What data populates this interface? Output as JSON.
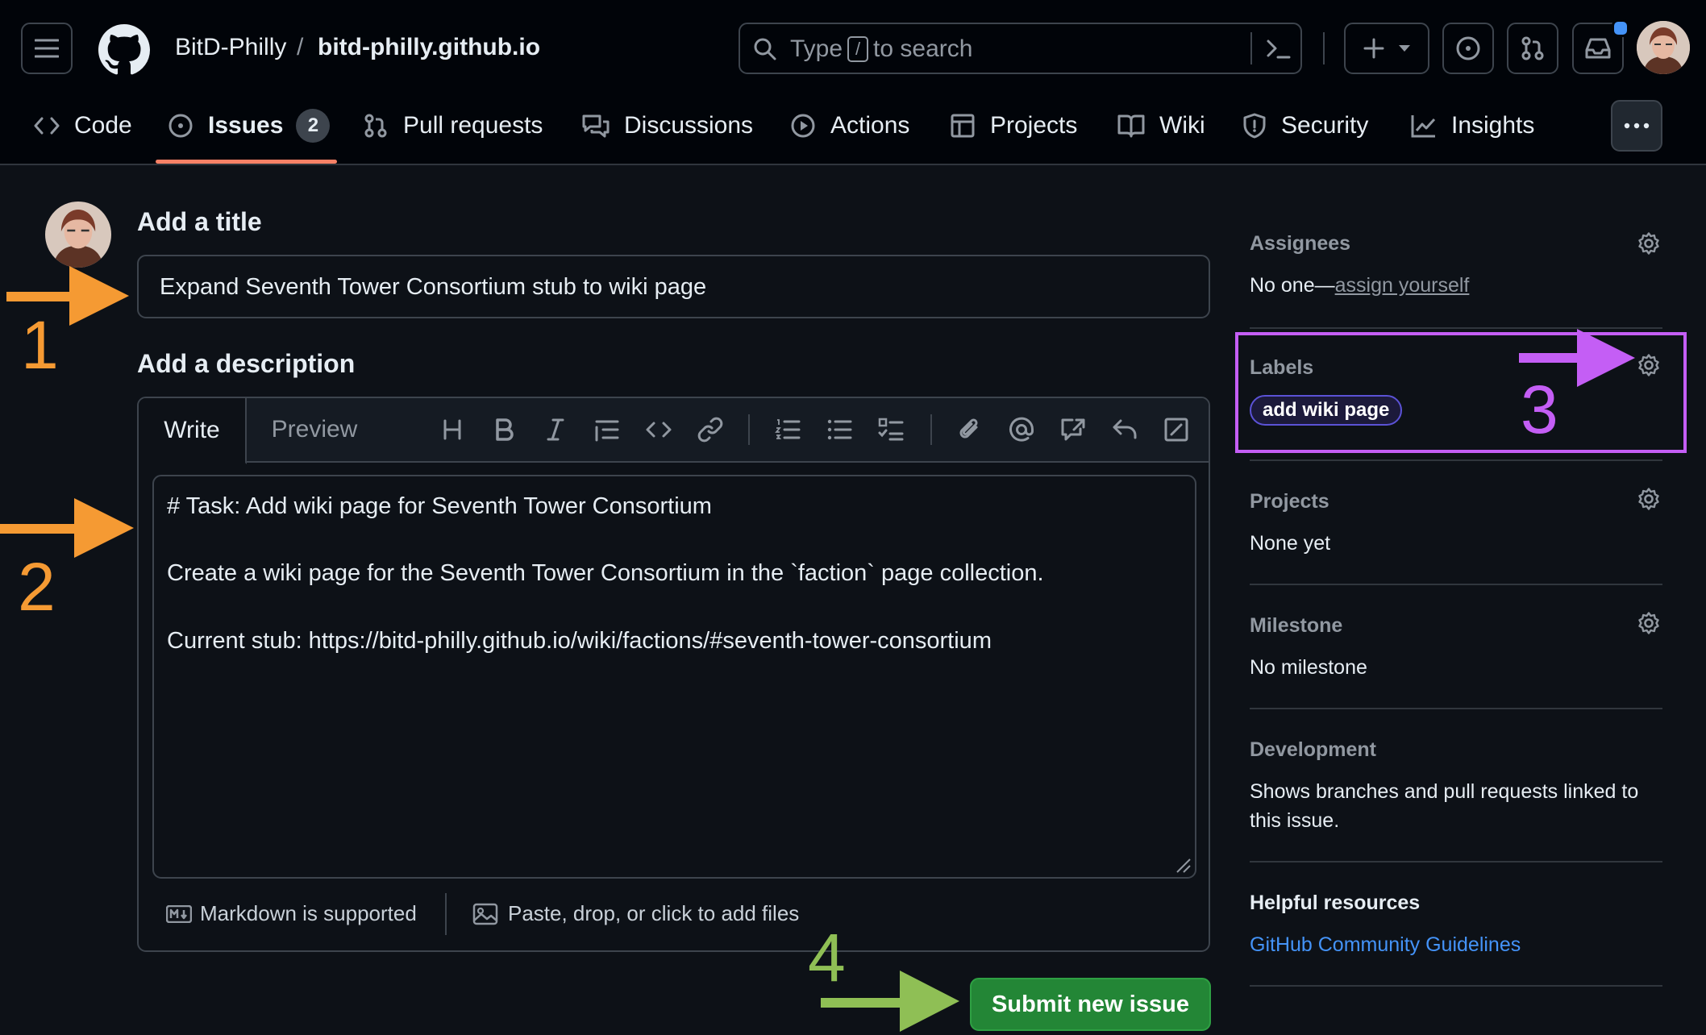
{
  "header": {
    "owner": "BitD-Philly",
    "separator": "/",
    "repo": "bitd-philly.github.io",
    "search": {
      "prefix": "Type",
      "key": "/",
      "suffix": "to search"
    }
  },
  "tabs": [
    {
      "label": "Code",
      "icon": "code-icon"
    },
    {
      "label": "Issues",
      "icon": "issue-opened-icon",
      "count": "2"
    },
    {
      "label": "Pull requests",
      "icon": "git-pull-request-icon"
    },
    {
      "label": "Discussions",
      "icon": "comment-discussion-icon"
    },
    {
      "label": "Actions",
      "icon": "play-icon"
    },
    {
      "label": "Projects",
      "icon": "table-icon"
    },
    {
      "label": "Wiki",
      "icon": "book-icon"
    },
    {
      "label": "Security",
      "icon": "shield-icon"
    },
    {
      "label": "Insights",
      "icon": "graph-icon"
    }
  ],
  "form": {
    "title_heading": "Add a title",
    "title_value": "Expand Seventh Tower Consortium stub to wiki page",
    "description_heading": "Add a description",
    "write_tab": "Write",
    "preview_tab": "Preview",
    "lines": [
      "# Task: Add wiki page for Seventh Tower Consortium",
      "Create a wiki page for the Seventh Tower Consortium in the `faction` page collection.",
      "Current stub: https://bitd-philly.github.io/wiki/factions/#seventh-tower-consortium"
    ],
    "markdown_note": "Markdown is supported",
    "attach_note": "Paste, drop, or click to add files",
    "submit_label": "Submit new issue"
  },
  "sidebar": {
    "assignees": {
      "heading": "Assignees",
      "text": "No one—",
      "link": "assign yourself"
    },
    "labels": {
      "heading": "Labels",
      "label": "add wiki page"
    },
    "projects": {
      "heading": "Projects",
      "text": "None yet"
    },
    "milestone": {
      "heading": "Milestone",
      "text": "No milestone"
    },
    "development": {
      "heading": "Development",
      "line1": "Shows branches and pull requests linked to",
      "line2": "this issue."
    },
    "resources": {
      "heading": "Helpful resources",
      "link": "GitHub Community Guidelines"
    }
  },
  "annotations": [
    "1",
    "2",
    "3",
    "4"
  ],
  "colors": {
    "background": "#0d1117",
    "accent_tab": "#f78166",
    "submit_green": "#238636",
    "link_blue": "#4493f8",
    "annotation_orange": "#f59a33",
    "annotation_purple": "#c45ef5",
    "annotation_green": "#8fbf55"
  }
}
